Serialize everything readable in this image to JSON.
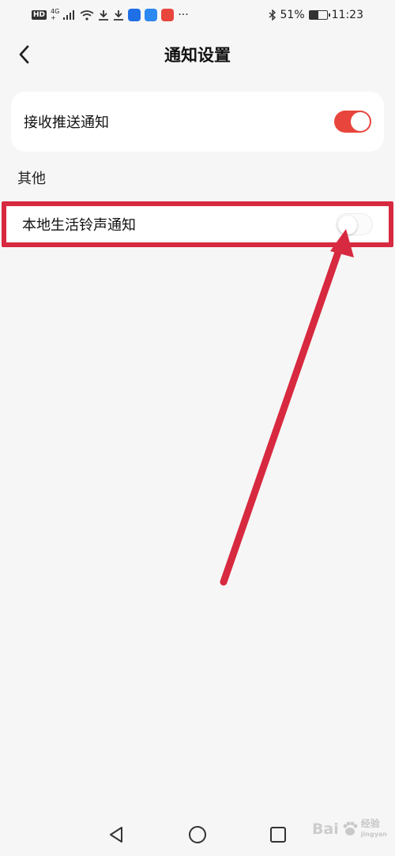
{
  "status_bar": {
    "network_badge": "HD",
    "network_type": "4G",
    "network_extra": "+",
    "more_icons": "···",
    "battery_percent": "51%",
    "battery_level": 0.51,
    "time": "11:23"
  },
  "header": {
    "title": "通知设置"
  },
  "settings": {
    "push_notifications": {
      "label": "接收推送通知",
      "enabled": true
    },
    "other_section_label": "其他",
    "local_ringtone": {
      "label": "本地生活铃声通知",
      "enabled": false
    }
  },
  "colors": {
    "accent_red": "#e8453c",
    "annotation_red": "#d7293f",
    "background": "#f6f6f6"
  },
  "watermark": {
    "brand": "Bai",
    "brand_suffix": "经验",
    "sub": "jingyan"
  },
  "icons": {
    "back": "chevron-left-icon",
    "nav_back": "triangle-back-icon",
    "nav_home": "circle-home-icon",
    "nav_recent": "square-recent-icon"
  }
}
